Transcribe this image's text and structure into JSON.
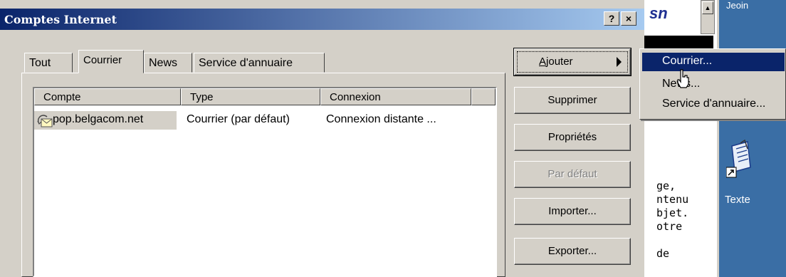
{
  "window": {
    "title": "Comptes Internet",
    "help": "?",
    "close": "×"
  },
  "tabs": [
    {
      "label": "Tout"
    },
    {
      "label": "Courrier"
    },
    {
      "label": "News"
    },
    {
      "label": "Service d'annuaire"
    }
  ],
  "list": {
    "columns": [
      "Compte",
      "Type",
      "Connexion"
    ],
    "rows": [
      {
        "account": "pop.belgacom.net",
        "type": "Courrier (par défaut)",
        "connection": "Connexion distante ..."
      }
    ]
  },
  "buttons": {
    "add_prefix": "A",
    "add_rest": "jouter",
    "delete": "Supprimer",
    "properties": "Propriétés",
    "default": "Par défaut",
    "import": "Importer...",
    "export": "Exporter..."
  },
  "menu": {
    "mail": "Courrier...",
    "news": "News...",
    "directory": "Service d'annuaire..."
  },
  "background": {
    "logo": "sn",
    "text": "ge,\nntenu\nbjet.\notre\n\nde"
  },
  "desktop": {
    "icon_label": "Texte",
    "top_text": "Jeoin"
  },
  "colors": {
    "titlebar": "#0a246a",
    "desktop": "#3a6ea5",
    "face": "#d4d0c8"
  }
}
